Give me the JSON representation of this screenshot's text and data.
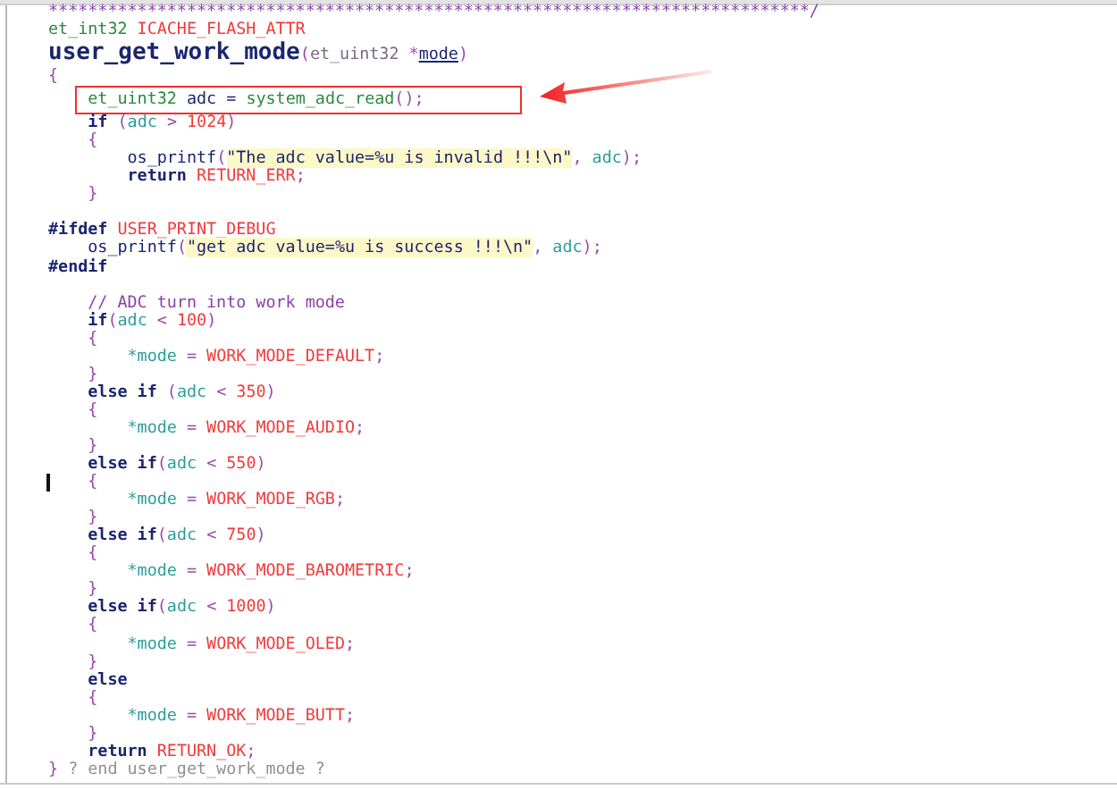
{
  "editor": {
    "lines": [
      {
        "kind": "code",
        "tokens": [
          {
            "text": "*****************************************************************************/",
            "kind": "comment"
          }
        ]
      },
      {
        "kind": "code",
        "tokens": [
          {
            "text": "et_int32",
            "kind": "type"
          },
          {
            "text": " ICACHE_FLASH_ATTR",
            "kind": "macro"
          }
        ]
      },
      {
        "kind": "signature",
        "tokens": [
          {
            "text": "user_get_work_mode",
            "kind": "funcdef"
          },
          {
            "text": "(",
            "kind": "punct"
          },
          {
            "text": "et_uint32 ",
            "kind": "paramtype"
          },
          {
            "text": "*",
            "kind": "punct"
          },
          {
            "text": "mode",
            "kind": "param"
          },
          {
            "text": ")",
            "kind": "punct"
          }
        ]
      },
      {
        "kind": "code",
        "tokens": [
          {
            "text": "{",
            "kind": "punct"
          }
        ]
      },
      {
        "kind": "code",
        "highlighted": true,
        "tokens": [
          {
            "text": "    et_uint32",
            "kind": "type"
          },
          {
            "text": " adc",
            "kind": "var"
          },
          {
            "text": " = ",
            "kind": "plain"
          },
          {
            "text": "system_adc_read",
            "kind": "call"
          },
          {
            "text": "();",
            "kind": "punct"
          }
        ]
      },
      {
        "kind": "code",
        "tokens": [
          {
            "text": "    if",
            "kind": "keyword"
          },
          {
            "text": " (",
            "kind": "punct"
          },
          {
            "text": "adc",
            "kind": "ident"
          },
          {
            "text": " > ",
            "kind": "punct"
          },
          {
            "text": "1024",
            "kind": "number"
          },
          {
            "text": ")",
            "kind": "punct"
          }
        ]
      },
      {
        "kind": "code",
        "tokens": [
          {
            "text": "    {",
            "kind": "punct"
          }
        ]
      },
      {
        "kind": "code",
        "tokens": [
          {
            "text": "        os_printf",
            "kind": "func"
          },
          {
            "text": "(",
            "kind": "punct"
          },
          {
            "text": "\"The adc value=%u is invalid !!!\\n\"",
            "kind": "string"
          },
          {
            "text": ", ",
            "kind": "punct"
          },
          {
            "text": "adc",
            "kind": "ident"
          },
          {
            "text": ");",
            "kind": "punct"
          }
        ]
      },
      {
        "kind": "code",
        "tokens": [
          {
            "text": "        return",
            "kind": "keyword"
          },
          {
            "text": " RETURN_ERR",
            "kind": "macro"
          },
          {
            "text": ";",
            "kind": "punct"
          }
        ]
      },
      {
        "kind": "code",
        "tokens": [
          {
            "text": "    }",
            "kind": "punct"
          }
        ]
      },
      {
        "kind": "blank"
      },
      {
        "kind": "code",
        "tokens": [
          {
            "text": "#ifdef",
            "kind": "keyword"
          },
          {
            "text": " USER_PRINT_DEBUG",
            "kind": "macro"
          }
        ]
      },
      {
        "kind": "code",
        "tokens": [
          {
            "text": "    os_printf",
            "kind": "func"
          },
          {
            "text": "(",
            "kind": "punct"
          },
          {
            "text": "\"get adc value=%u is success !!!\\n\"",
            "kind": "string"
          },
          {
            "text": ", ",
            "kind": "punct"
          },
          {
            "text": "adc",
            "kind": "ident"
          },
          {
            "text": ");",
            "kind": "punct"
          }
        ]
      },
      {
        "kind": "code",
        "tokens": [
          {
            "text": "#endif",
            "kind": "keyword"
          }
        ]
      },
      {
        "kind": "blank"
      },
      {
        "kind": "code",
        "tokens": [
          {
            "text": "    // ADC turn into work mode",
            "kind": "comment"
          }
        ]
      },
      {
        "kind": "code",
        "tokens": [
          {
            "text": "    if",
            "kind": "keyword"
          },
          {
            "text": "(",
            "kind": "punct"
          },
          {
            "text": "adc",
            "kind": "ident"
          },
          {
            "text": " < ",
            "kind": "punct"
          },
          {
            "text": "100",
            "kind": "number"
          },
          {
            "text": ")",
            "kind": "punct"
          }
        ]
      },
      {
        "kind": "code",
        "tokens": [
          {
            "text": "    {",
            "kind": "punct"
          }
        ]
      },
      {
        "kind": "code",
        "tokens": [
          {
            "text": "        *mode",
            "kind": "ident"
          },
          {
            "text": " = ",
            "kind": "punct"
          },
          {
            "text": "WORK_MODE_DEFAULT",
            "kind": "macro"
          },
          {
            "text": ";",
            "kind": "punct"
          }
        ]
      },
      {
        "kind": "code",
        "tokens": [
          {
            "text": "    }",
            "kind": "punct"
          }
        ]
      },
      {
        "kind": "code",
        "tokens": [
          {
            "text": "    else if",
            "kind": "keyword"
          },
          {
            "text": " (",
            "kind": "punct"
          },
          {
            "text": "adc",
            "kind": "ident"
          },
          {
            "text": " < ",
            "kind": "punct"
          },
          {
            "text": "350",
            "kind": "number"
          },
          {
            "text": ")",
            "kind": "punct"
          }
        ]
      },
      {
        "kind": "code",
        "tokens": [
          {
            "text": "    {",
            "kind": "punct"
          }
        ]
      },
      {
        "kind": "code",
        "tokens": [
          {
            "text": "        *mode",
            "kind": "ident"
          },
          {
            "text": " = ",
            "kind": "punct"
          },
          {
            "text": "WORK_MODE_AUDIO",
            "kind": "macro"
          },
          {
            "text": ";",
            "kind": "punct"
          }
        ]
      },
      {
        "kind": "code",
        "tokens": [
          {
            "text": "    }",
            "kind": "punct"
          }
        ]
      },
      {
        "kind": "code",
        "tokens": [
          {
            "text": "    else if",
            "kind": "keyword"
          },
          {
            "text": "(",
            "kind": "punct"
          },
          {
            "text": "adc",
            "kind": "ident"
          },
          {
            "text": " < ",
            "kind": "punct"
          },
          {
            "text": "550",
            "kind": "number"
          },
          {
            "text": ")",
            "kind": "punct"
          }
        ]
      },
      {
        "kind": "code",
        "cursor": true,
        "tokens": [
          {
            "text": "    {",
            "kind": "punct"
          }
        ]
      },
      {
        "kind": "code",
        "tokens": [
          {
            "text": "        *mode",
            "kind": "ident"
          },
          {
            "text": " = ",
            "kind": "punct"
          },
          {
            "text": "WORK_MODE_RGB",
            "kind": "macro"
          },
          {
            "text": ";",
            "kind": "punct"
          }
        ]
      },
      {
        "kind": "code",
        "tokens": [
          {
            "text": "    }",
            "kind": "punct"
          }
        ]
      },
      {
        "kind": "code",
        "tokens": [
          {
            "text": "    else if",
            "kind": "keyword"
          },
          {
            "text": "(",
            "kind": "punct"
          },
          {
            "text": "adc",
            "kind": "ident"
          },
          {
            "text": " < ",
            "kind": "punct"
          },
          {
            "text": "750",
            "kind": "number"
          },
          {
            "text": ")",
            "kind": "punct"
          }
        ]
      },
      {
        "kind": "code",
        "tokens": [
          {
            "text": "    {",
            "kind": "punct"
          }
        ]
      },
      {
        "kind": "code",
        "tokens": [
          {
            "text": "        *mode",
            "kind": "ident"
          },
          {
            "text": " = ",
            "kind": "punct"
          },
          {
            "text": "WORK_MODE_BAROMETRIC",
            "kind": "macro"
          },
          {
            "text": ";",
            "kind": "punct"
          }
        ]
      },
      {
        "kind": "code",
        "tokens": [
          {
            "text": "    }",
            "kind": "punct"
          }
        ]
      },
      {
        "kind": "code",
        "tokens": [
          {
            "text": "    else if",
            "kind": "keyword"
          },
          {
            "text": "(",
            "kind": "punct"
          },
          {
            "text": "adc",
            "kind": "ident"
          },
          {
            "text": " < ",
            "kind": "punct"
          },
          {
            "text": "1000",
            "kind": "number"
          },
          {
            "text": ")",
            "kind": "punct"
          }
        ]
      },
      {
        "kind": "code",
        "tokens": [
          {
            "text": "    {",
            "kind": "punct"
          }
        ]
      },
      {
        "kind": "code",
        "tokens": [
          {
            "text": "        *mode",
            "kind": "ident"
          },
          {
            "text": " = ",
            "kind": "punct"
          },
          {
            "text": "WORK_MODE_OLED",
            "kind": "macro"
          },
          {
            "text": ";",
            "kind": "punct"
          }
        ]
      },
      {
        "kind": "code",
        "tokens": [
          {
            "text": "    }",
            "kind": "punct"
          }
        ]
      },
      {
        "kind": "code",
        "tokens": [
          {
            "text": "    else",
            "kind": "keyword"
          }
        ]
      },
      {
        "kind": "code",
        "tokens": [
          {
            "text": "    {",
            "kind": "punct"
          }
        ]
      },
      {
        "kind": "code",
        "tokens": [
          {
            "text": "        *mode",
            "kind": "ident"
          },
          {
            "text": " = ",
            "kind": "punct"
          },
          {
            "text": "WORK_MODE_BUTT",
            "kind": "macro"
          },
          {
            "text": ";",
            "kind": "punct"
          }
        ]
      },
      {
        "kind": "code",
        "tokens": [
          {
            "text": "    }",
            "kind": "punct"
          }
        ]
      },
      {
        "kind": "code",
        "tokens": [
          {
            "text": "    return",
            "kind": "keyword"
          },
          {
            "text": " RETURN_OK",
            "kind": "macro"
          },
          {
            "text": ";",
            "kind": "punct"
          }
        ]
      },
      {
        "kind": "code",
        "tokens": [
          {
            "text": "}",
            "kind": "punct"
          },
          {
            "text": " ? end user_get_work_mode ?",
            "kind": "note"
          }
        ]
      }
    ]
  }
}
